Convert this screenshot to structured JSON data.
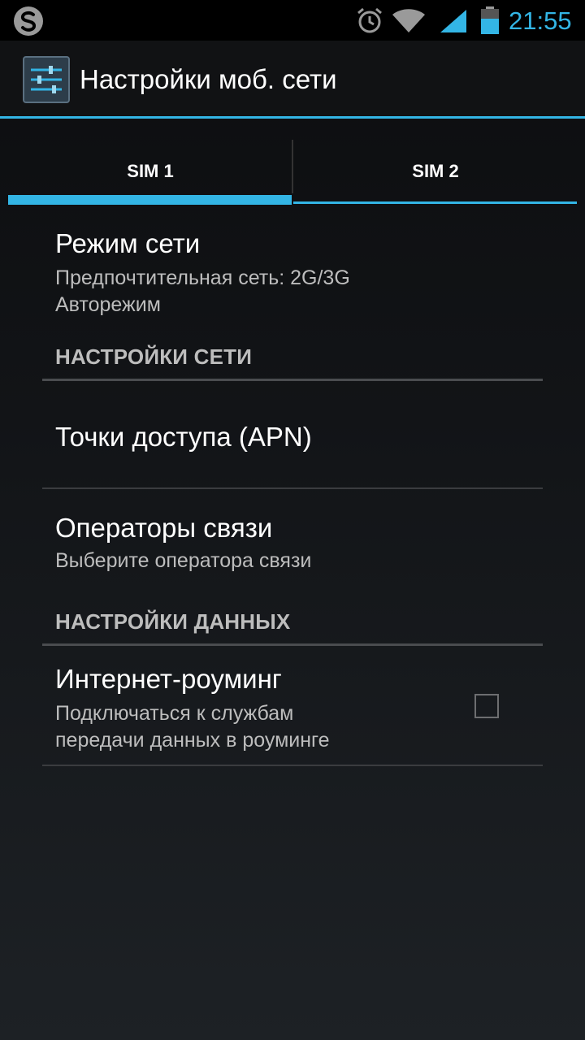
{
  "status_bar": {
    "time": "21:55",
    "icons": [
      "s-logo-icon",
      "alarm-icon",
      "wifi-icon",
      "signal-icon",
      "battery-icon"
    ],
    "accent_color": "#33b5e5"
  },
  "action_bar": {
    "title": "Настройки моб. сети",
    "icon": "settings-sliders-icon"
  },
  "tabs": [
    {
      "label": "SIM 1",
      "selected": true
    },
    {
      "label": "SIM 2",
      "selected": false
    }
  ],
  "network_mode": {
    "title": "Режим сети",
    "summary_line1": "Предпочтительная сеть: 2G/3G",
    "summary_line2": "Авторежим"
  },
  "category_network": "НАСТРОЙКИ СЕТИ",
  "apn": {
    "title": "Точки доступа (APN)"
  },
  "operators": {
    "title": "Операторы связи",
    "summary": "Выберите оператора связи"
  },
  "category_data": "НАСТРОЙКИ ДАННЫХ",
  "roaming": {
    "title": "Интернет-роуминг",
    "summary_line1": "Подключаться к службам",
    "summary_line2": "передачи данных в роуминге",
    "checked": false
  }
}
